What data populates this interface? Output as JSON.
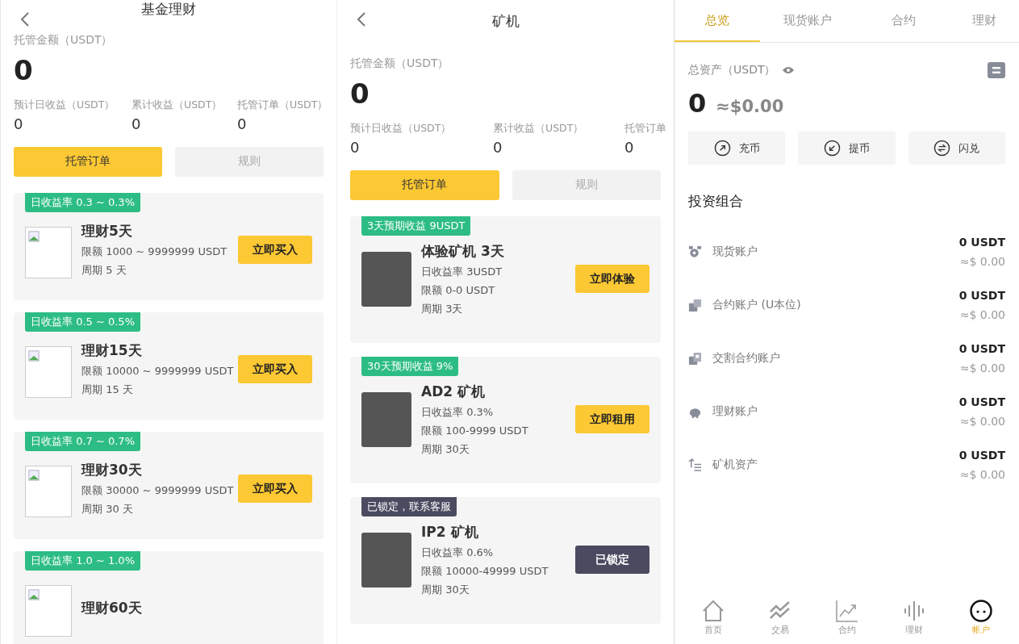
{
  "fund": {
    "title": "基金理财",
    "amount_label": "托管金额（USDT）",
    "amount": "0",
    "stats": [
      {
        "label": "预计日收益（USDT）",
        "value": "0"
      },
      {
        "label": "累计收益（USDT）",
        "value": "0"
      },
      {
        "label": "托管订单（USDT）",
        "value": "0"
      }
    ],
    "tabs": [
      {
        "label": "托管订单",
        "selected": true
      },
      {
        "label": "规则",
        "selected": false
      }
    ],
    "products": [
      {
        "tag": "日收益率  0.3 ~ 0.3%",
        "name": "理财5天",
        "limit": "限额 1000 ~ 9999999 USDT",
        "period": "周期 5 天",
        "button": "立即买入"
      },
      {
        "tag": "日收益率  0.5 ~ 0.5%",
        "name": "理财15天",
        "limit": "限额 10000 ~ 9999999 USDT",
        "period": "周期 15 天",
        "button": "立即买入"
      },
      {
        "tag": "日收益率  0.7 ~ 0.7%",
        "name": "理财30天",
        "limit": "限额 30000 ~ 9999999 USDT",
        "period": "周期 30 天",
        "button": "立即买入"
      },
      {
        "tag": "日收益率  1.0 ~ 1.0%",
        "name": "理财60天"
      }
    ]
  },
  "miner": {
    "title": "矿机",
    "amount_label": "托管金额（USDT）",
    "amount": "0",
    "stats": [
      {
        "label": "预计日收益（USDT）",
        "value": "0"
      },
      {
        "label": "累计收益（USDT）",
        "value": "0"
      },
      {
        "label": "托管订单",
        "value": "0"
      }
    ],
    "tabs": [
      {
        "label": "托管订单",
        "selected": true
      },
      {
        "label": "规则",
        "selected": false
      }
    ],
    "machines": [
      {
        "tag": "3天预期收益 9USDT",
        "name": "体验矿机 3天",
        "rate": "日收益率 3USDT",
        "limit": "限额 0-0 USDT",
        "period": "周期 3天",
        "button": "立即体验",
        "locked": false
      },
      {
        "tag": "30天预期收益 9%",
        "name": "AD2 矿机",
        "rate": "日收益率 0.3%",
        "limit": "限额 100-9999 USDT",
        "period": "周期 30天",
        "button": "立即租用",
        "locked": false
      },
      {
        "tag": "已锁定，联系客服",
        "name": "IP2 矿机",
        "rate": "日收益率 0.6%",
        "limit": "限额 10000-49999 USDT",
        "period": "周期 30天",
        "button": "已锁定",
        "locked": true
      }
    ]
  },
  "account": {
    "tabs": [
      {
        "label": "总览",
        "selected": true
      },
      {
        "label": "现货账户",
        "selected": false
      },
      {
        "label": "合约",
        "selected": false
      },
      {
        "label": "理财",
        "selected": false
      }
    ],
    "total_label": "总资产（USDT）",
    "total": "0",
    "total_usd": "≈$0.00",
    "actions": [
      {
        "kind": "deposit",
        "label": "充币"
      },
      {
        "kind": "withdraw",
        "label": "提币"
      },
      {
        "kind": "swap",
        "label": "闪兑"
      }
    ],
    "portfolio_title": "投资组合",
    "accounts": [
      {
        "kind": "spot",
        "name": "现货账户",
        "amount": "0 USDT",
        "usd": "≈$ 0.00"
      },
      {
        "kind": "contract",
        "name": "合约账户 (U本位)",
        "amount": "0 USDT",
        "usd": "≈$ 0.00"
      },
      {
        "kind": "delivery",
        "name": "交割合约账户",
        "amount": "0 USDT",
        "usd": "≈$ 0.00"
      },
      {
        "kind": "finance",
        "name": "理财账户",
        "amount": "0 USDT",
        "usd": "≈$ 0.00"
      },
      {
        "kind": "miner",
        "name": "矿机资产",
        "amount": "0 USDT",
        "usd": "≈$ 0.00"
      }
    ],
    "nav": [
      {
        "kind": "home",
        "label": "首页",
        "selected": false
      },
      {
        "kind": "trade",
        "label": "交易",
        "selected": false
      },
      {
        "kind": "contract",
        "label": "合约",
        "selected": false
      },
      {
        "kind": "finance",
        "label": "理财",
        "selected": false
      },
      {
        "kind": "account",
        "label": "帐户",
        "selected": true
      }
    ]
  }
}
